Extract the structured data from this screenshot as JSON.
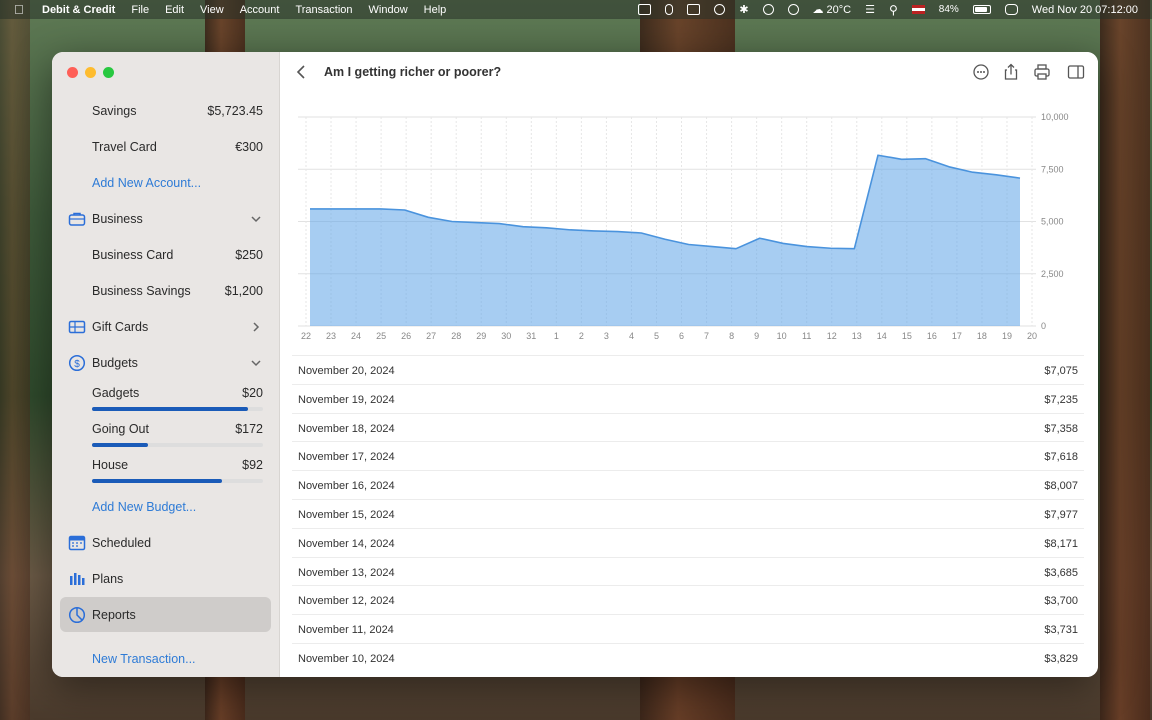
{
  "menubar": {
    "app_name": "Debit & Credit",
    "menus": [
      "File",
      "Edit",
      "View",
      "Account",
      "Transaction",
      "Window",
      "Help"
    ],
    "weather": "20°C",
    "battery": "84%",
    "datetime": "Wed Nov 20  07:12:00"
  },
  "window": {
    "title": "Am I getting richer or poorer?"
  },
  "sidebar": {
    "accounts": [
      {
        "label": "Savings",
        "amount": "$5,723.45"
      },
      {
        "label": "Travel Card",
        "amount": "€300"
      }
    ],
    "add_account": "Add New Account...",
    "business": {
      "label": "Business",
      "items": [
        {
          "label": "Business Card",
          "amount": "$250"
        },
        {
          "label": "Business Savings",
          "amount": "$1,200"
        }
      ]
    },
    "gift_cards": "Gift Cards",
    "budgets": {
      "label": "Budgets",
      "items": [
        {
          "label": "Gadgets",
          "amount": "$20",
          "progress": 0.91
        },
        {
          "label": "Going Out",
          "amount": "$172",
          "progress": 0.33
        },
        {
          "label": "House",
          "amount": "$92",
          "progress": 0.76
        }
      ]
    },
    "add_budget": "Add New Budget...",
    "scheduled": "Scheduled",
    "plans": "Plans",
    "reports": "Reports",
    "new_transaction": "New Transaction..."
  },
  "chart_data": {
    "type": "area",
    "x": [
      "22",
      "23",
      "24",
      "25",
      "26",
      "27",
      "28",
      "29",
      "30",
      "31",
      "1",
      "2",
      "3",
      "4",
      "5",
      "6",
      "7",
      "8",
      "9",
      "10",
      "11",
      "12",
      "13",
      "14",
      "15",
      "16",
      "17",
      "18",
      "19",
      "20"
    ],
    "values": [
      5600,
      5600,
      5600,
      5600,
      5550,
      5200,
      5000,
      4950,
      4900,
      4750,
      4700,
      4600,
      4550,
      4520,
      4450,
      4150,
      3900,
      3800,
      3700,
      4200,
      3950,
      3800,
      3720,
      3700,
      8171,
      7977,
      8007,
      7618,
      7358,
      7235,
      7075
    ],
    "ylim": [
      0,
      10000
    ],
    "yticks": [
      "10,000",
      "7,500",
      "5,000",
      "2,500",
      "0"
    ],
    "color": "#5ea4e8",
    "grid": true
  },
  "rows": [
    {
      "date": "November 20, 2024",
      "value": "$7,075"
    },
    {
      "date": "November 19, 2024",
      "value": "$7,235"
    },
    {
      "date": "November 18, 2024",
      "value": "$7,358"
    },
    {
      "date": "November 17, 2024",
      "value": "$7,618"
    },
    {
      "date": "November 16, 2024",
      "value": "$8,007"
    },
    {
      "date": "November 15, 2024",
      "value": "$7,977"
    },
    {
      "date": "November 14, 2024",
      "value": "$8,171"
    },
    {
      "date": "November 13, 2024",
      "value": "$3,685"
    },
    {
      "date": "November 12, 2024",
      "value": "$3,700"
    },
    {
      "date": "November 11, 2024",
      "value": "$3,731"
    },
    {
      "date": "November 10, 2024",
      "value": "$3,829"
    }
  ]
}
